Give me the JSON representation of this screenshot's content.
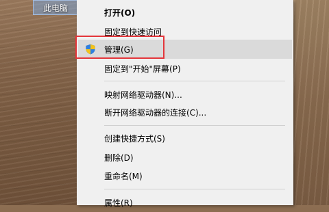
{
  "desktop": {
    "icon_label": "此电脑"
  },
  "context_menu": {
    "items": [
      {
        "label": "打开(O)",
        "bold": true
      },
      {
        "label": "固定到快速访问"
      },
      {
        "label": "管理(G)",
        "icon": "uac-shield-icon",
        "hovered": true
      },
      {
        "label": "固定到\"开始\"屏幕(P)"
      },
      {
        "label": "映射网络驱动器(N)..."
      },
      {
        "label": "断开网络驱动器的连接(C)..."
      },
      {
        "label": "创建快捷方式(S)"
      },
      {
        "label": "删除(D)"
      },
      {
        "label": "重命名(M)"
      },
      {
        "label": "属性(R)"
      }
    ]
  },
  "annotation": {
    "highlight_color": "#e4353a"
  }
}
